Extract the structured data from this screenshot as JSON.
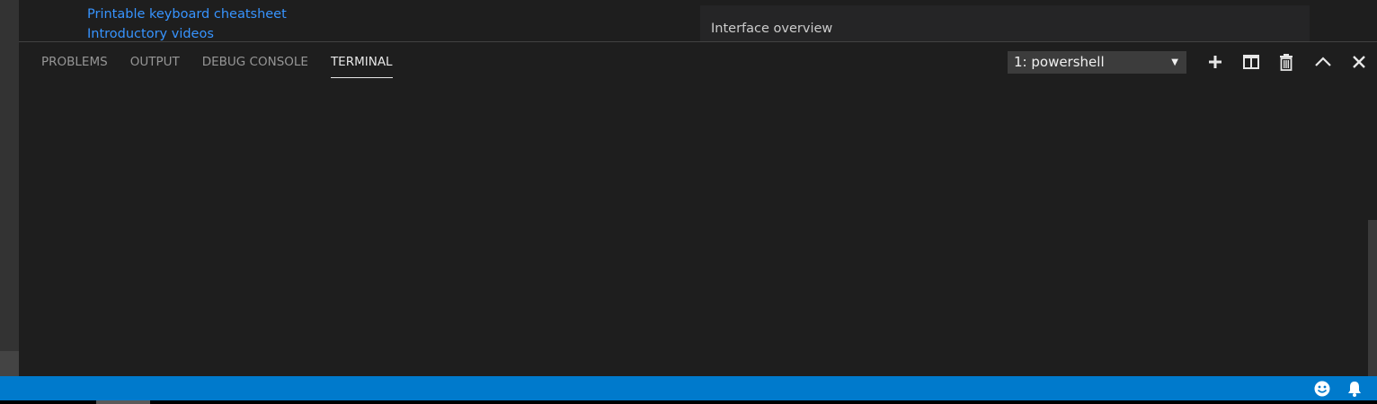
{
  "editor": {
    "links": [
      "Printable keyboard cheatsheet",
      "Introductory videos"
    ],
    "overview_card_title": "Interface overview"
  },
  "panel": {
    "tabs": [
      {
        "label": "PROBLEMS",
        "active": false
      },
      {
        "label": "OUTPUT",
        "active": false
      },
      {
        "label": "DEBUG CONSOLE",
        "active": false
      },
      {
        "label": "TERMINAL",
        "active": true
      }
    ],
    "terminal_select": {
      "selected": "1: powershell"
    },
    "actions": [
      "new-terminal",
      "split-terminal",
      "kill-terminal",
      "maximize-panel",
      "close-panel"
    ]
  },
  "status_bar": {
    "color": "#007acc",
    "icons": [
      "smiley-feedback-icon",
      "bell-notifications-icon"
    ]
  },
  "colors": {
    "accent_link": "#3794ff",
    "panel_bg": "#1e1e1e"
  }
}
